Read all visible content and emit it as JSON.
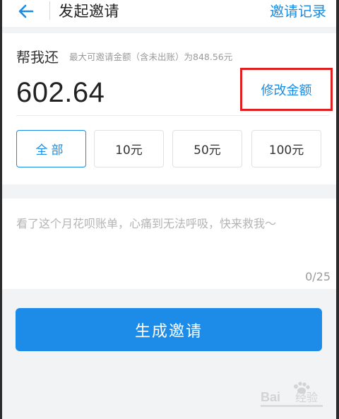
{
  "header": {
    "title": "发起邀请",
    "records_label": "邀请记录"
  },
  "help": {
    "label": "帮我还",
    "max_info": "最大可邀请金额（含未出账）为848.56元",
    "amount": "602.64",
    "modify_label": "修改金额"
  },
  "options": [
    {
      "label": "全部",
      "selected": true
    },
    {
      "label": "10元",
      "selected": false
    },
    {
      "label": "50元",
      "selected": false
    },
    {
      "label": "100元",
      "selected": false
    }
  ],
  "message": {
    "text": "看了这个月花呗账单，心痛到无法呼吸，快来救我～",
    "count": "0/25"
  },
  "generate_label": "生成邀请",
  "watermark": {
    "brand": "Bai",
    "brand_suffix": "经验"
  },
  "colors": {
    "accent": "#1a8ce3",
    "highlight_box": "#e02020"
  }
}
